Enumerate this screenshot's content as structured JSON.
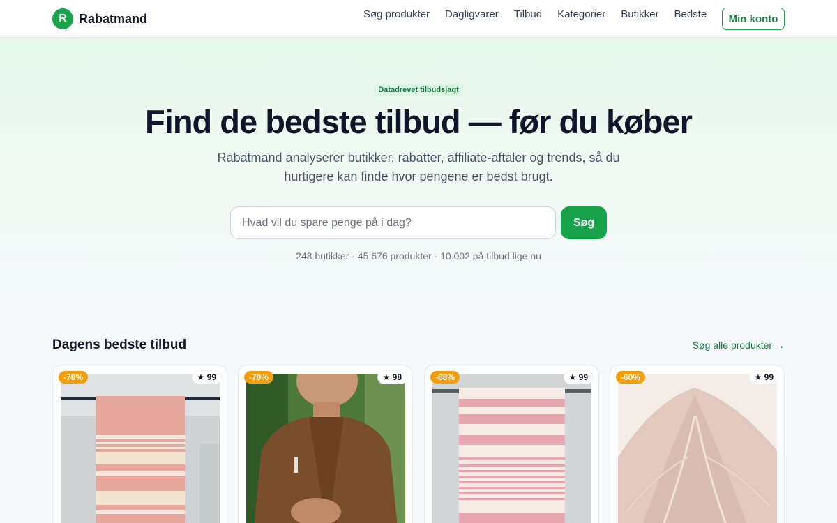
{
  "brand": {
    "logo_letter": "R",
    "name": "Rabatmand",
    "accent": "#16a34a"
  },
  "nav": {
    "items": [
      {
        "label": "Søg produkter"
      },
      {
        "label": "Dagligvarer"
      },
      {
        "label": "Tilbud"
      },
      {
        "label": "Kategorier"
      },
      {
        "label": "Butikker"
      },
      {
        "label": "Bedste"
      }
    ],
    "account_label": "Min konto"
  },
  "hero": {
    "badge": "Datadrevet tilbudsjagt",
    "title": "Find de bedste tilbud — før du køber",
    "subtitle": "Rabatmand analyserer butikker, rabatter, affiliate-aftaler og trends, så du hurtigere kan finde hvor pengene er bedst brugt.",
    "search_placeholder": "Hvad vil du spare penge på i dag?",
    "search_value": "",
    "search_button": "Søg",
    "stats": "248 butikker · 45.676 produkter · 10.002 på tilbud lige nu"
  },
  "deals": {
    "title": "Dagens bedste tilbud",
    "link": "Søg alle produkter →",
    "cards": [
      {
        "discount": "-78%",
        "rating": "★ 99",
        "image": "pink-striped-towel"
      },
      {
        "discount": "-70%",
        "rating": "★ 98",
        "image": "brown-zip-sweater"
      },
      {
        "discount": "-68%",
        "rating": "★ 99",
        "image": "pink-striped-towel-rail"
      },
      {
        "discount": "-60%",
        "rating": "★ 99",
        "image": "knitted-blanket"
      }
    ]
  }
}
